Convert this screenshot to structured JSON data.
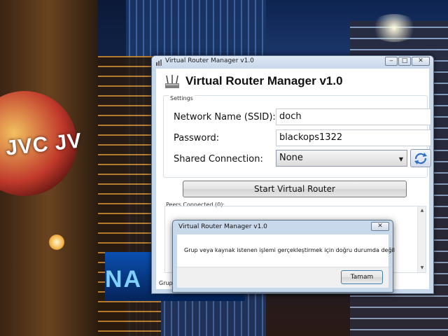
{
  "main_window": {
    "titlebar": {
      "title": "Virtual Router Manager v1.0"
    },
    "header_title": "Virtual Router Manager v1.0",
    "settings": {
      "group_label": "Settings",
      "ssid_label": "Network Name (SSID):",
      "ssid_value": "doch",
      "password_label": "Password:",
      "password_value": "blackops1322",
      "shared_label": "Shared Connection:",
      "shared_value": "None"
    },
    "start_button": "Start Virtual Router",
    "peers_label": "Peers Connected (0):",
    "status_text": "Grup v"
  },
  "dialog": {
    "title": "Virtual Router Manager v1.0",
    "message": "Grup veya kaynak istenen işlemi gerçekleştirmek için doğru durumda değil",
    "ok_button": "Tamam"
  },
  "wallpaper_text": {
    "globe": "JVC JV",
    "sign": "NA"
  },
  "icons": {
    "app": "router-antenna-icon",
    "refresh": "refresh-arrows-icon"
  },
  "colors": {
    "window_frame": "#c9d9ec",
    "accent": "#2f6fc0"
  }
}
